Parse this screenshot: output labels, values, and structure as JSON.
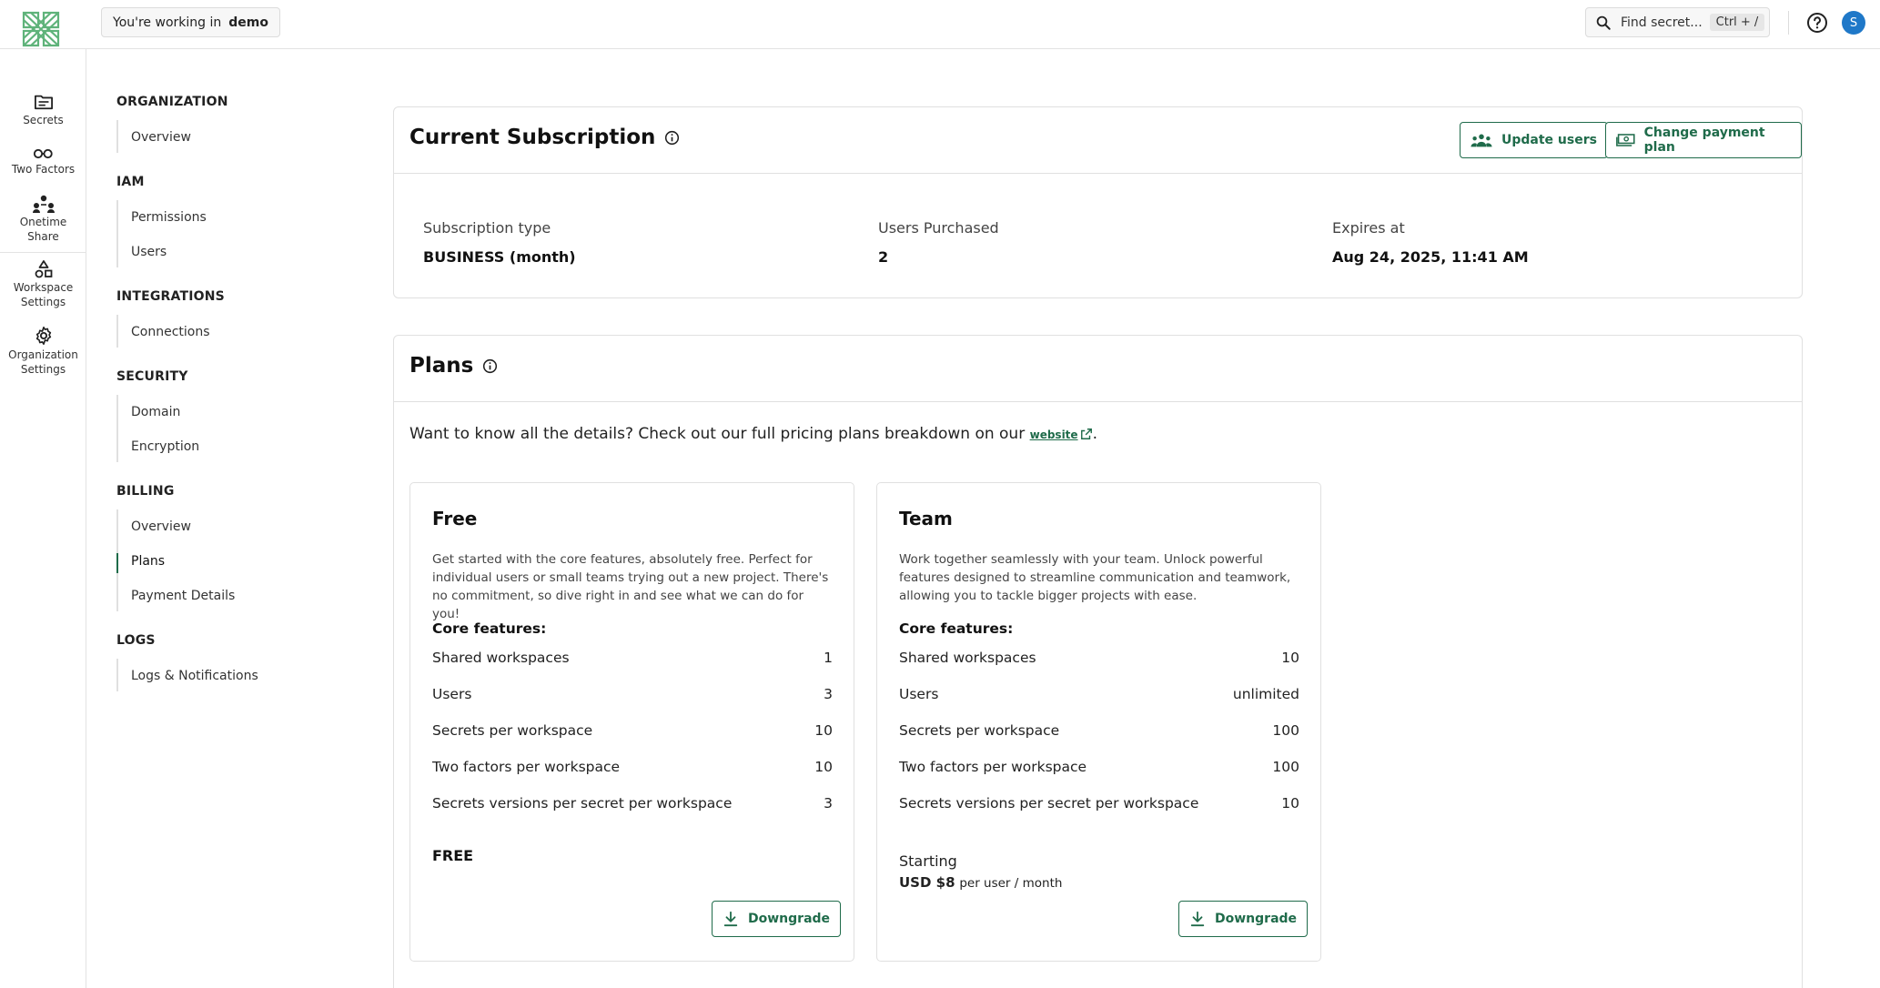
{
  "topbar": {
    "working_in_label": "You're working in",
    "workspace_name": "demo",
    "search_placeholder": "Find secret...",
    "search_shortcut": "Ctrl + /",
    "avatar_initial": "S"
  },
  "rail": {
    "items": [
      {
        "label": "Secrets",
        "icon": "folder-icon"
      },
      {
        "label": "Two Factors",
        "icon": "key-icon"
      },
      {
        "label_line1": "Onetime",
        "label_line2": "Share",
        "icon": "share-users-icon"
      },
      {
        "label_line1": "Workspace",
        "label_line2": "Settings",
        "icon": "shapes-icon"
      },
      {
        "label_line1": "Organization",
        "label_line2": "Settings",
        "icon": "gear-icon"
      }
    ]
  },
  "nav": {
    "sections": [
      {
        "title": "ORGANIZATION",
        "items": [
          "Overview"
        ]
      },
      {
        "title": "IAM",
        "items": [
          "Permissions",
          "Users"
        ]
      },
      {
        "title": "INTEGRATIONS",
        "items": [
          "Connections"
        ]
      },
      {
        "title": "SECURITY",
        "items": [
          "Domain",
          "Encryption"
        ]
      },
      {
        "title": "BILLING",
        "items": [
          "Overview",
          "Plans",
          "Payment Details"
        ]
      },
      {
        "title": "LOGS",
        "items": [
          "Logs & Notifications"
        ]
      }
    ],
    "active": "Plans"
  },
  "subscription": {
    "title": "Current Subscription",
    "update_users_label": "Update users",
    "change_plan_label": "Change payment plan",
    "type_label": "Subscription type",
    "type_value": "BUSINESS (month)",
    "users_label": "Users Purchased",
    "users_value": "2",
    "expires_label": "Expires at",
    "expires_value": "Aug 24, 2025, 11:41 AM"
  },
  "plans": {
    "title": "Plans",
    "intro_text": "Want to know all the details? Check out our full pricing plans breakdown on our",
    "intro_link": "website",
    "intro_end": ".",
    "core_label": "Core features:",
    "list": [
      {
        "name": "Free",
        "description": "Get started with the core features, absolutely free. Perfect for individual users or small teams trying out a new project. There's no commitment, so dive right in and see what we can do for you!",
        "features": [
          {
            "label": "Shared workspaces",
            "value": "1"
          },
          {
            "label": "Users",
            "value": "3"
          },
          {
            "label": "Secrets per workspace",
            "value": "10"
          },
          {
            "label": "Two factors per workspace",
            "value": "10"
          },
          {
            "label": "Secrets versions per secret per workspace",
            "value": "3"
          }
        ],
        "price": "FREE",
        "action_label": "Downgrade"
      },
      {
        "name": "Team",
        "description": "Work together seamlessly with your team. Unlock powerful features designed to streamline communication and teamwork, allowing you to tackle bigger projects with ease.",
        "features": [
          {
            "label": "Shared workspaces",
            "value": "10"
          },
          {
            "label": "Users",
            "value": "unlimited"
          },
          {
            "label": "Secrets per workspace",
            "value": "100"
          },
          {
            "label": "Two factors per workspace",
            "value": "100"
          },
          {
            "label": "Secrets versions per secret per workspace",
            "value": "10"
          }
        ],
        "starting_label": "Starting",
        "price_amount": "USD $8",
        "price_unit": "per user / month",
        "action_label": "Downgrade"
      }
    ]
  },
  "colors": {
    "accent": "#1f6b4a",
    "avatar": "#1f78c8",
    "logo": "#5fb37a"
  }
}
